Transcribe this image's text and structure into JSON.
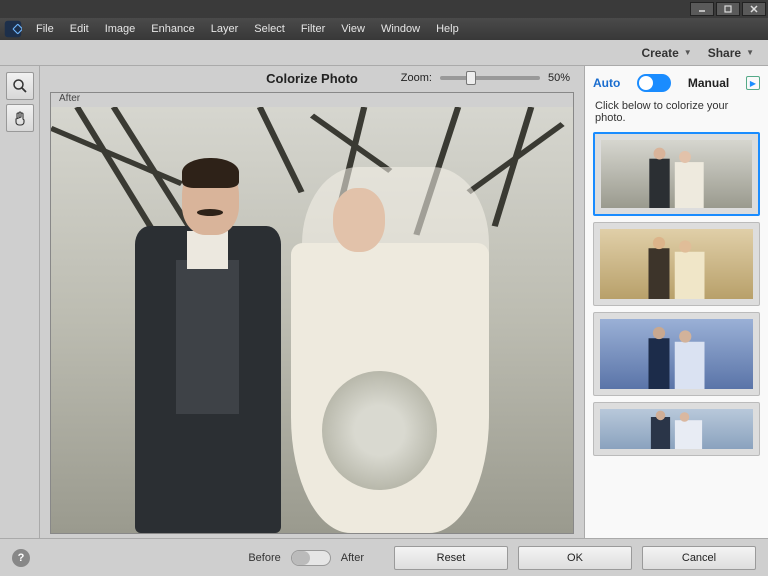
{
  "menu": {
    "items": [
      "File",
      "Edit",
      "Image",
      "Enhance",
      "Layer",
      "Select",
      "Filter",
      "View",
      "Window",
      "Help"
    ]
  },
  "actionbar": {
    "create": "Create",
    "share": "Share"
  },
  "dialog": {
    "title": "Colorize Photo",
    "zoom_label": "Zoom:",
    "zoom_value": "50%",
    "after_tag": "After"
  },
  "rightpanel": {
    "auto_label": "Auto",
    "manual_label": "Manual",
    "hint": "Click below to colorize your photo.",
    "options": [
      {
        "id": "opt1",
        "selected": true,
        "tint": "none"
      },
      {
        "id": "opt2",
        "selected": false,
        "tint": "sepia"
      },
      {
        "id": "opt3",
        "selected": false,
        "tint": "blue"
      },
      {
        "id": "opt4",
        "selected": false,
        "tint": "cool"
      }
    ]
  },
  "footer": {
    "before_label": "Before",
    "after_label": "After",
    "reset": "Reset",
    "ok": "OK",
    "cancel": "Cancel",
    "help_glyph": "?"
  }
}
